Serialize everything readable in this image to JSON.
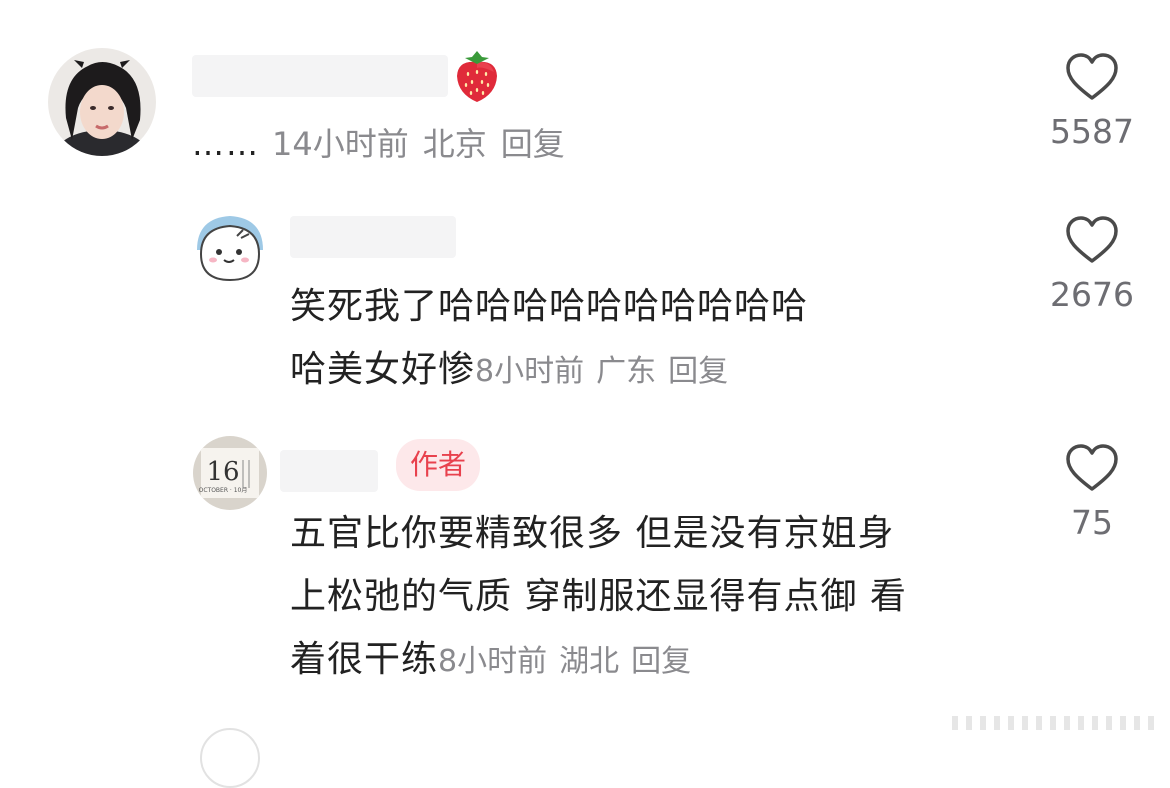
{
  "comments": [
    {
      "prefix": "……",
      "time": "14小时前",
      "location": "北京",
      "reply_label": "回复",
      "likes": "5587",
      "emoji": "strawberry-icon"
    },
    {
      "line1": "笑死我了哈哈哈哈哈哈哈哈哈哈",
      "line2": "哈美女好惨",
      "time": "8小时前",
      "location": "广东",
      "reply_label": "回复",
      "likes": "2676"
    },
    {
      "badge": "作者",
      "line1": "五官比你要精致很多 但是没有京姐身",
      "line2": "上松弛的气质 穿制服还显得有点御 看",
      "line3": "着很干练",
      "time": "8小时前",
      "location": "湖北",
      "reply_label": "回复",
      "likes": "75"
    }
  ],
  "avatar_calendar": {
    "day": "16",
    "month_text": "OCTOBER · 10月"
  },
  "colors": {
    "text": "#222222",
    "meta": "#8a8a8e",
    "badge_bg": "#fde8ea",
    "badge_fg": "#e8414d",
    "like_outline": "#4a4a4a"
  }
}
